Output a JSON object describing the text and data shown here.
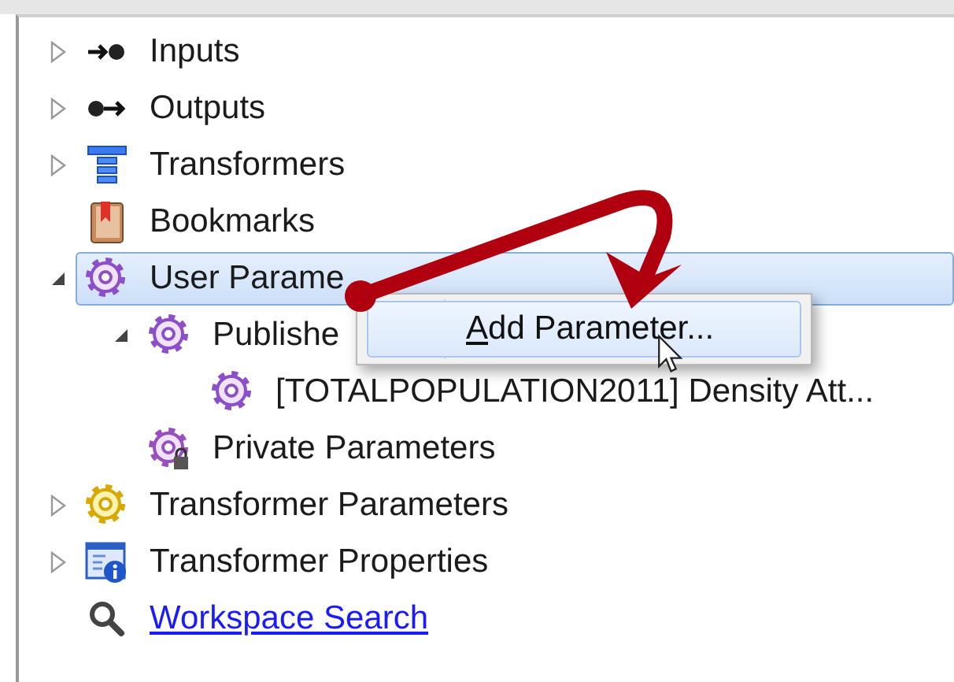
{
  "tree": [
    {
      "kind": "branch",
      "label": "Inputs",
      "expanded": false,
      "selected": false
    },
    {
      "kind": "branch",
      "label": "Outputs",
      "expanded": false,
      "selected": false
    },
    {
      "kind": "branch",
      "label": "Transformers",
      "expanded": false,
      "selected": false
    },
    {
      "kind": "leaf",
      "label": "Bookmarks",
      "selected": false
    },
    {
      "kind": "branch",
      "label": "User Parame",
      "expanded": true,
      "selected": true,
      "children": [
        {
          "kind": "branch",
          "label": "Publishe",
          "expanded": true,
          "selected": false,
          "children": [
            {
              "kind": "leaf",
              "label": "[TOTALPOPULATION2011] Density Att...",
              "selected": false
            }
          ]
        },
        {
          "kind": "leaf",
          "label": "Private Parameters",
          "selected": false
        }
      ]
    },
    {
      "kind": "branch",
      "label": "Transformer Parameters",
      "expanded": false,
      "selected": false
    },
    {
      "kind": "branch",
      "label": "Transformer Properties",
      "expanded": false,
      "selected": false
    },
    {
      "kind": "link",
      "label": "Workspace Search",
      "selected": false
    }
  ],
  "context_menu": {
    "items": [
      {
        "label": "Add Parameter...",
        "selected": true
      }
    ]
  }
}
